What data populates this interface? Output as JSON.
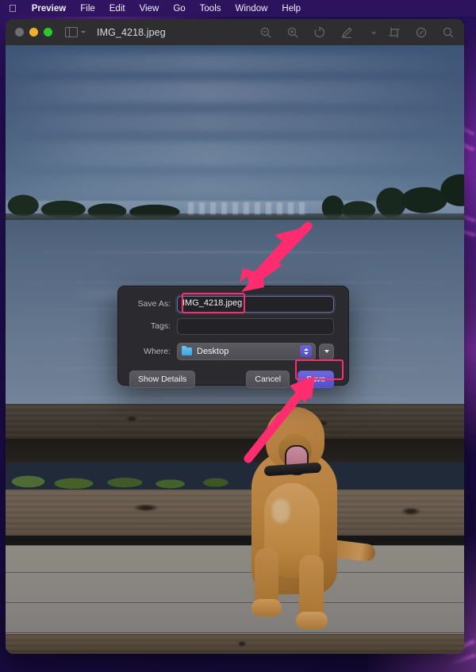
{
  "menubar": {
    "apple_glyph": "",
    "items": [
      {
        "label": "Preview",
        "bold": true
      },
      {
        "label": "File"
      },
      {
        "label": "Edit"
      },
      {
        "label": "View"
      },
      {
        "label": "Go"
      },
      {
        "label": "Tools"
      },
      {
        "label": "Window"
      },
      {
        "label": "Help"
      }
    ]
  },
  "window": {
    "title": "IMG_4218.jpeg",
    "traffic_lights": [
      "close",
      "minimize",
      "maximize"
    ],
    "toolbar_icons": [
      "zoom-out-icon",
      "zoom-in-icon",
      "rotate-icon",
      "markup-icon",
      "chevron-down-icon",
      "crop-icon",
      "annotate-icon",
      "search-icon"
    ],
    "sidebar_toggle": "sidebar-icon"
  },
  "dialog": {
    "save_as_label": "Save As:",
    "save_as_value": "IMG_4218.jpeg",
    "tags_label": "Tags:",
    "tags_value": "",
    "tags_placeholder": "",
    "where_label": "Where:",
    "where_value": "Desktop",
    "show_details_label": "Show Details",
    "cancel_label": "Cancel",
    "save_label": "Save"
  },
  "annotations": {
    "highlight_color": "#ff2d6f",
    "arrow_color": "#ff2d6f",
    "targets": [
      "save-as-field",
      "save-button"
    ]
  },
  "colors": {
    "accent": "#6059cf",
    "desktop": "#2a1160",
    "window_chrome": "#2e2e31",
    "dialog_bg": "#2b2b2f",
    "highlight": "#ff2d6f"
  }
}
